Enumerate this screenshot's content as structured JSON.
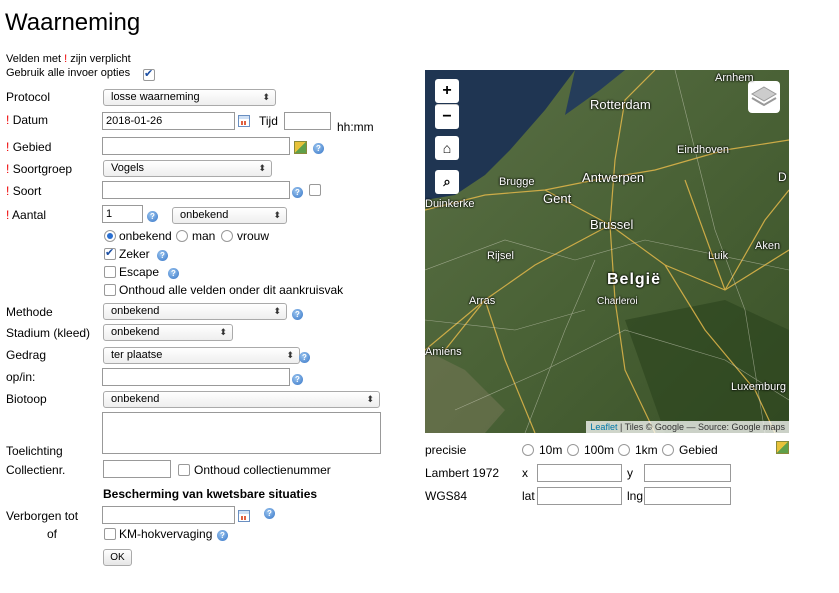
{
  "page": {
    "title": "Waarneming"
  },
  "intro": {
    "required_note_pre": "Velden met ",
    "required_mark": "!",
    "required_note_post": " zijn verplicht",
    "all_options": "Gebruik alle invoer opties"
  },
  "labels": {
    "protocol": "Protocol",
    "datum": "Datum",
    "gebied": "Gebied",
    "soortgroep": "Soortgroep",
    "soort": "Soort",
    "aantal": "Aantal",
    "methode": "Methode",
    "stadium": "Stadium (kleed)",
    "gedrag": "Gedrag",
    "opin": "op/in:",
    "biotoop": "Biotoop",
    "toelichting": "Toelichting",
    "collectienr": "Collectienr.",
    "verborgen": "Verborgen tot",
    "of": "of"
  },
  "fields": {
    "protocol": "losse waarneming",
    "datum": "2018-01-26",
    "tijd_label": "Tijd",
    "tijd_unit": "hh:mm",
    "soortgroep": "Vogels",
    "aantal": "1",
    "aantal_sex_select": "onbekend",
    "methode": "onbekend",
    "stadium": "onbekend",
    "gedrag": "ter plaatse",
    "biotoop": "onbekend"
  },
  "sex_options": [
    "onbekend",
    "man",
    "vrouw"
  ],
  "checks": {
    "zeker": "Zeker",
    "escape": "Escape",
    "onthoud_alle": "Onthoud alle velden onder dit aankruisvak",
    "onthoud_collectie": "Onthoud collectienummer",
    "km": "KM-hokvervaging"
  },
  "section": {
    "bescherming": "Bescherming van kwetsbare situaties"
  },
  "ok_button": "OK",
  "map": {
    "zoom_in": "+",
    "zoom_out": "−",
    "cities": [
      "Arnhem",
      "Rotterdam",
      "Eindhoven",
      "Brugge",
      "Antwerpen",
      "Gent",
      "Duinkerke",
      "Brussel",
      "Rijsel",
      "Luik",
      "Aken",
      "België",
      "Arras",
      "Charleroi",
      "Amiens",
      "Luxemburg",
      "D"
    ],
    "attribution_link": "Leaflet",
    "attribution_text": " | Tiles © Google — Source: Google maps"
  },
  "coords": {
    "precisie": "precisie",
    "precisie_options": [
      "10m",
      "100m",
      "1km",
      "Gebied"
    ],
    "lambert": "Lambert 1972",
    "x": "x",
    "y": "y",
    "wgs84": "WGS84",
    "lat": "lat",
    "lng": "lng"
  }
}
